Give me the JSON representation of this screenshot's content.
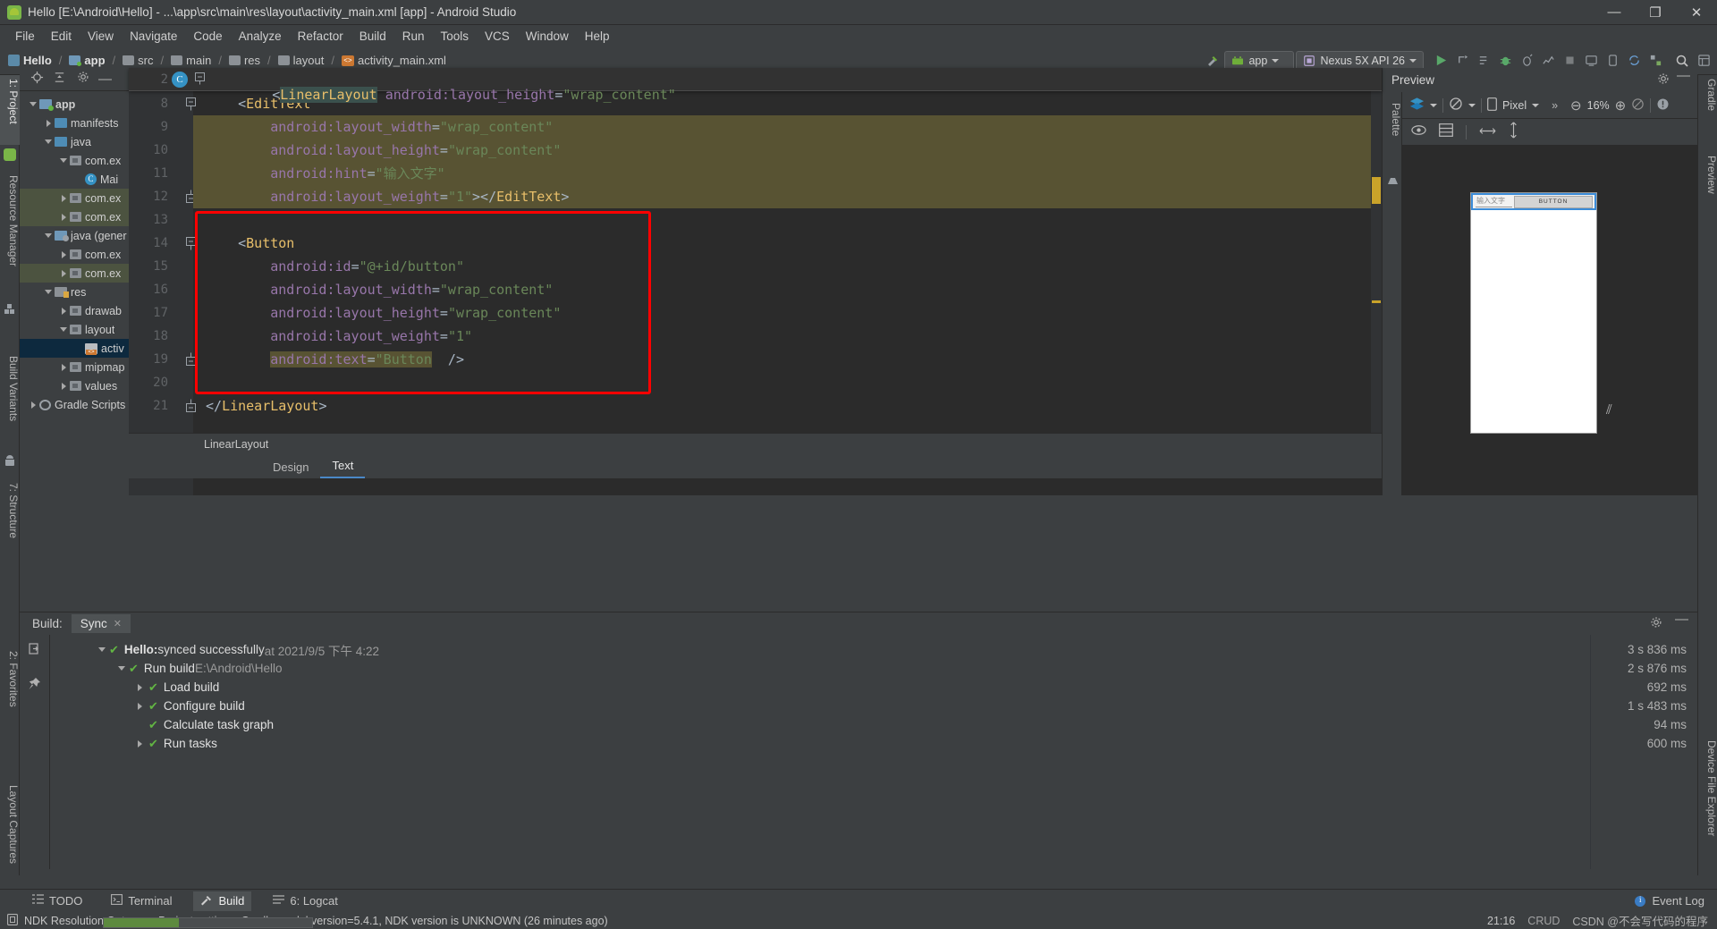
{
  "window": {
    "title": "Hello [E:\\Android\\Hello] - ...\\app\\src\\main\\res\\layout\\activity_main.xml [app] - Android Studio",
    "minimize": "—",
    "maximize": "❐",
    "close": "✕"
  },
  "menubar": [
    "File",
    "Edit",
    "View",
    "Navigate",
    "Code",
    "Analyze",
    "Refactor",
    "Build",
    "Run",
    "Tools",
    "VCS",
    "Window",
    "Help"
  ],
  "breadcrumb": [
    {
      "label": "Hello",
      "icon": "module-icon",
      "bold": true
    },
    {
      "label": "app",
      "icon": "module-green-icon",
      "bold": true
    },
    {
      "label": "src",
      "icon": "folder-icon",
      "bold": false
    },
    {
      "label": "main",
      "icon": "folder-icon",
      "bold": false
    },
    {
      "label": "res",
      "icon": "res-folder-icon",
      "bold": false
    },
    {
      "label": "layout",
      "icon": "folder-icon",
      "bold": false
    },
    {
      "label": "activity_main.xml",
      "icon": "xml-file-icon",
      "bold": false
    }
  ],
  "toolbar": {
    "run_config": "app",
    "device": "Nexus 5X API 26",
    "run_tooltip": "Run",
    "search_tooltip": "Search Everywhere"
  },
  "left_strip": [
    "1: Project",
    "Resource Manager",
    "Build Variants"
  ],
  "left_strip_bottom": [
    "2: Favorites",
    "Layout Captures",
    "7: Structure"
  ],
  "right_strip": [
    "Gradle",
    "Preview",
    "Device File Explorer"
  ],
  "project": {
    "title": "Project",
    "tree": [
      {
        "label": "app",
        "depth": 0,
        "arrow": "down",
        "icon": "module-green-icon",
        "bold": true,
        "state": "normal"
      },
      {
        "label": "manifests",
        "depth": 1,
        "arrow": "right",
        "icon": "folder-blue-icon",
        "bold": false,
        "state": "normal"
      },
      {
        "label": "java",
        "depth": 1,
        "arrow": "down",
        "icon": "folder-blue-icon",
        "bold": false,
        "state": "normal"
      },
      {
        "label": "com.ex",
        "depth": 2,
        "arrow": "down",
        "icon": "package-icon",
        "bold": false,
        "state": "normal"
      },
      {
        "label": "Mai",
        "depth": 3,
        "arrow": "none",
        "icon": "class-icon",
        "bold": false,
        "state": "normal"
      },
      {
        "label": "com.ex",
        "depth": 2,
        "arrow": "right",
        "icon": "package-icon",
        "bold": false,
        "state": "green"
      },
      {
        "label": "com.ex",
        "depth": 2,
        "arrow": "right",
        "icon": "package-icon",
        "bold": false,
        "state": "green"
      },
      {
        "label": "java (gener",
        "depth": 1,
        "arrow": "down",
        "icon": "generated-icon",
        "bold": false,
        "state": "normal"
      },
      {
        "label": "com.ex",
        "depth": 2,
        "arrow": "right",
        "icon": "package-icon",
        "bold": false,
        "state": "normal"
      },
      {
        "label": "com.ex",
        "depth": 2,
        "arrow": "right",
        "icon": "package-icon",
        "bold": false,
        "state": "green"
      },
      {
        "label": "res",
        "depth": 1,
        "arrow": "down",
        "icon": "res-folder-icon",
        "bold": false,
        "state": "normal"
      },
      {
        "label": "drawab",
        "depth": 2,
        "arrow": "right",
        "icon": "package-icon",
        "bold": false,
        "state": "normal"
      },
      {
        "label": "layout",
        "depth": 2,
        "arrow": "down",
        "icon": "package-icon",
        "bold": false,
        "state": "normal"
      },
      {
        "label": "activ",
        "depth": 3,
        "arrow": "none",
        "icon": "xml-file-icon",
        "bold": false,
        "state": "selected"
      },
      {
        "label": "mipmap",
        "depth": 2,
        "arrow": "right",
        "icon": "package-icon",
        "bold": false,
        "state": "normal"
      },
      {
        "label": "values",
        "depth": 2,
        "arrow": "right",
        "icon": "package-icon",
        "bold": false,
        "state": "normal"
      },
      {
        "label": "Gradle Scripts",
        "depth": 0,
        "arrow": "right",
        "icon": "gradle-icon",
        "bold": false,
        "state": "normal"
      }
    ]
  },
  "editor": {
    "sticky_line_number": "2",
    "sticky_code": "<LinearLayout android:layout_height=\"wrap_content\"",
    "sticky_tag": "LinearLayout",
    "lines": [
      {
        "no": "8",
        "indent": 4,
        "segments": [
          {
            "t": "<",
            "c": "pun"
          },
          {
            "t": "EditText",
            "c": "tag"
          }
        ],
        "fold": "start",
        "hl": "none"
      },
      {
        "no": "9",
        "indent": 8,
        "segments": [
          {
            "t": "android:layout_width",
            "c": "attr"
          },
          {
            "t": "=",
            "c": "eq"
          },
          {
            "t": "\"wrap_content\"",
            "c": "val"
          }
        ],
        "fold": "none",
        "hl": "olive"
      },
      {
        "no": "10",
        "indent": 8,
        "segments": [
          {
            "t": "android:layout_height",
            "c": "attr"
          },
          {
            "t": "=",
            "c": "eq"
          },
          {
            "t": "\"wrap_content\"",
            "c": "val"
          }
        ],
        "fold": "none",
        "hl": "olive"
      },
      {
        "no": "11",
        "indent": 8,
        "segments": [
          {
            "t": "android:hint",
            "c": "attr"
          },
          {
            "t": "=",
            "c": "eq"
          },
          {
            "t": "\"输入文字\"",
            "c": "val"
          }
        ],
        "fold": "none",
        "hl": "olive"
      },
      {
        "no": "12",
        "indent": 8,
        "segments": [
          {
            "t": "android:layout_weight",
            "c": "attr"
          },
          {
            "t": "=",
            "c": "eq"
          },
          {
            "t": "\"1\"",
            "c": "val"
          },
          {
            "t": "></",
            "c": "pun"
          },
          {
            "t": "EditText",
            "c": "tag"
          },
          {
            "t": ">",
            "c": "pun"
          }
        ],
        "fold": "end",
        "hl": "olive"
      },
      {
        "no": "13",
        "indent": 0,
        "segments": [],
        "fold": "none",
        "hl": "none"
      },
      {
        "no": "14",
        "indent": 4,
        "segments": [
          {
            "t": "<",
            "c": "pun"
          },
          {
            "t": "Button",
            "c": "tag"
          }
        ],
        "fold": "start",
        "hl": "none"
      },
      {
        "no": "15",
        "indent": 8,
        "segments": [
          {
            "t": "android:id",
            "c": "attr"
          },
          {
            "t": "=",
            "c": "eq"
          },
          {
            "t": "\"@+id/button\"",
            "c": "val"
          }
        ],
        "fold": "none",
        "hl": "none"
      },
      {
        "no": "16",
        "indent": 8,
        "segments": [
          {
            "t": "android:layout_width",
            "c": "attr"
          },
          {
            "t": "=",
            "c": "eq"
          },
          {
            "t": "\"wrap_content\"",
            "c": "val"
          }
        ],
        "fold": "none",
        "hl": "none"
      },
      {
        "no": "17",
        "indent": 8,
        "segments": [
          {
            "t": "android:layout_height",
            "c": "attr"
          },
          {
            "t": "=",
            "c": "eq"
          },
          {
            "t": "\"wrap_content\"",
            "c": "val"
          }
        ],
        "fold": "none",
        "hl": "none"
      },
      {
        "no": "18",
        "indent": 8,
        "segments": [
          {
            "t": "android:layout_weight",
            "c": "attr"
          },
          {
            "t": "=",
            "c": "eq"
          },
          {
            "t": "\"1\"",
            "c": "val"
          }
        ],
        "fold": "none",
        "hl": "none"
      },
      {
        "no": "19",
        "indent": 8,
        "segments": [
          {
            "t": "android:text",
            "c": "attr"
          },
          {
            "t": "=",
            "c": "eq"
          },
          {
            "t": "\"Button",
            "c": "val"
          },
          {
            "t": "  />",
            "c": "pun"
          }
        ],
        "fold": "end",
        "hl": "olive-partial"
      },
      {
        "no": "20",
        "indent": 0,
        "segments": [],
        "fold": "none",
        "hl": "none"
      },
      {
        "no": "21",
        "indent": 0,
        "segments": [
          {
            "t": "</",
            "c": "pun"
          },
          {
            "t": "LinearLayout",
            "c": "tag"
          },
          {
            "t": ">",
            "c": "pun"
          }
        ],
        "fold": "end",
        "hl": "none"
      }
    ],
    "breadcrumb_element": "LinearLayout",
    "tabs": [
      {
        "label": "Design",
        "active": false
      },
      {
        "label": "Text",
        "active": true
      }
    ]
  },
  "preview": {
    "title": "Preview",
    "palette_label": "Palette",
    "device_name": "Pixel",
    "zoom_level": "16%",
    "overflow": "»",
    "zoom_out": "⊖",
    "zoom_in": "⊕",
    "render": {
      "hint_text": "输入文字",
      "button_text": "BUTTON"
    }
  },
  "build_panel": {
    "label": "Build:",
    "tab": "Sync",
    "tab_close": "✕",
    "rows": [
      {
        "depth": 0,
        "arrow": "down",
        "title": "Hello:",
        "bold": true,
        "rest": " synced successfully",
        "dim": " at 2021/9/5 下午 4:22",
        "time": "3 s 836 ms"
      },
      {
        "depth": 1,
        "arrow": "down",
        "title": "Run build",
        "bold": false,
        "rest": "",
        "dim": " E:\\Android\\Hello",
        "time": "2 s 876 ms"
      },
      {
        "depth": 2,
        "arrow": "right",
        "title": "Load build",
        "bold": false,
        "rest": "",
        "dim": "",
        "time": "692 ms"
      },
      {
        "depth": 2,
        "arrow": "right",
        "title": "Configure build",
        "bold": false,
        "rest": "",
        "dim": "",
        "time": "1 s 483 ms"
      },
      {
        "depth": 2,
        "arrow": "none",
        "title": "Calculate task graph",
        "bold": false,
        "rest": "",
        "dim": "",
        "time": "94 ms"
      },
      {
        "depth": 2,
        "arrow": "right",
        "title": "Run tasks",
        "bold": false,
        "rest": "",
        "dim": "",
        "time": "600 ms"
      }
    ]
  },
  "bottom_bar": {
    "items": [
      {
        "label": "TODO",
        "icon": "todo-icon",
        "active": false
      },
      {
        "label": "Terminal",
        "icon": "terminal-icon",
        "active": false
      },
      {
        "label": "Build",
        "icon": "build-hammer-icon",
        "active": true
      },
      {
        "label": "6: Logcat",
        "icon": "logcat-icon",
        "active": false
      }
    ],
    "event_log": "Event Log"
  },
  "status_bar": {
    "message": "NDK Resolution Outcome: Project settings: Gradle model version=5.4.1, NDK version is UNKNOWN (26 minutes ago)",
    "time": "21:16",
    "watermark": "CSDN @不会写代码的程序",
    "watermark2": "CRUD"
  },
  "colors": {
    "accent": "#3a7cc4",
    "success": "#62b543",
    "highlight_box": "#ff0000",
    "editor_bg": "#2b2b2b",
    "panel_bg": "#3c3f41",
    "selection": "#0d293e"
  }
}
